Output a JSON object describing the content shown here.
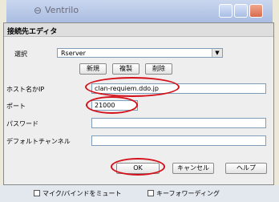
{
  "background_window": {
    "app_title": "Ventrilo"
  },
  "dialog": {
    "title": "接続先エディタ",
    "select_label": "選択",
    "select_value": "Rserver",
    "buttons": {
      "new": "新規",
      "copy": "複製",
      "delete": "削除",
      "ok": "OK",
      "cancel": "キャンセル",
      "help": "ヘルプ"
    },
    "fields": {
      "host_label": "ホスト名かIP",
      "host_value": "clan-requiem.ddo.jp",
      "port_label": "ポート",
      "port_value": "21000",
      "password_label": "パスワード",
      "password_value": "",
      "channel_label": "デフォルトチャンネル",
      "channel_value": ""
    }
  },
  "bottom_bar": {
    "mute_label": "マイク/バインドをミュート",
    "fwd_label": "キーフォワーディング"
  },
  "colors": {
    "highlight": "#d4101a"
  }
}
